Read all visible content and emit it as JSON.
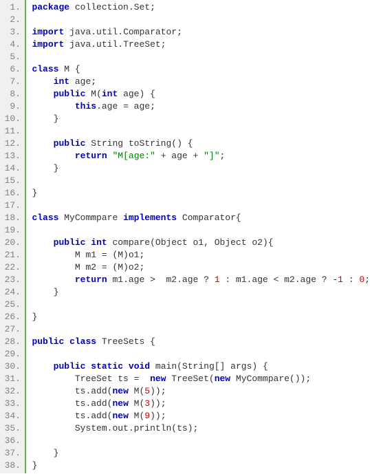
{
  "lines": [
    {
      "n": "1.",
      "tokens": [
        {
          "cls": "kw",
          "t": "package"
        },
        {
          "cls": "pln",
          "t": " collection.Set;"
        }
      ]
    },
    {
      "n": "2.",
      "tokens": []
    },
    {
      "n": "3.",
      "tokens": [
        {
          "cls": "kw",
          "t": "import"
        },
        {
          "cls": "pln",
          "t": " java.util.Comparator;"
        }
      ]
    },
    {
      "n": "4.",
      "tokens": [
        {
          "cls": "kw",
          "t": "import"
        },
        {
          "cls": "pln",
          "t": " java.util.TreeSet;"
        }
      ]
    },
    {
      "n": "5.",
      "tokens": []
    },
    {
      "n": "6.",
      "tokens": [
        {
          "cls": "kw",
          "t": "class"
        },
        {
          "cls": "pln",
          "t": " M {"
        }
      ]
    },
    {
      "n": "7.",
      "tokens": [
        {
          "cls": "pln",
          "t": "    "
        },
        {
          "cls": "kw",
          "t": "int"
        },
        {
          "cls": "pln",
          "t": " age;"
        }
      ]
    },
    {
      "n": "8.",
      "tokens": [
        {
          "cls": "pln",
          "t": "    "
        },
        {
          "cls": "kw",
          "t": "public"
        },
        {
          "cls": "pln",
          "t": " M("
        },
        {
          "cls": "kw",
          "t": "int"
        },
        {
          "cls": "pln",
          "t": " age) {"
        }
      ]
    },
    {
      "n": "9.",
      "tokens": [
        {
          "cls": "pln",
          "t": "        "
        },
        {
          "cls": "kw",
          "t": "this"
        },
        {
          "cls": "pln",
          "t": ".age = age;"
        }
      ]
    },
    {
      "n": "10.",
      "tokens": [
        {
          "cls": "pln",
          "t": "    }"
        }
      ]
    },
    {
      "n": "11.",
      "tokens": []
    },
    {
      "n": "12.",
      "tokens": [
        {
          "cls": "pln",
          "t": "    "
        },
        {
          "cls": "kw",
          "t": "public"
        },
        {
          "cls": "pln",
          "t": " String toString() {"
        }
      ]
    },
    {
      "n": "13.",
      "tokens": [
        {
          "cls": "pln",
          "t": "        "
        },
        {
          "cls": "kw",
          "t": "return"
        },
        {
          "cls": "pln",
          "t": " "
        },
        {
          "cls": "str",
          "t": "\"M[age:\""
        },
        {
          "cls": "pln",
          "t": " + age + "
        },
        {
          "cls": "str",
          "t": "\"]\""
        },
        {
          "cls": "pln",
          "t": ";"
        }
      ]
    },
    {
      "n": "14.",
      "tokens": [
        {
          "cls": "pln",
          "t": "    }"
        }
      ]
    },
    {
      "n": "15.",
      "tokens": []
    },
    {
      "n": "16.",
      "tokens": [
        {
          "cls": "pln",
          "t": "}"
        }
      ]
    },
    {
      "n": "17.",
      "tokens": []
    },
    {
      "n": "18.",
      "tokens": [
        {
          "cls": "kw",
          "t": "class"
        },
        {
          "cls": "pln",
          "t": " MyCommpare "
        },
        {
          "cls": "kw",
          "t": "implements"
        },
        {
          "cls": "pln",
          "t": " Comparator{"
        }
      ]
    },
    {
      "n": "19.",
      "tokens": []
    },
    {
      "n": "20.",
      "tokens": [
        {
          "cls": "pln",
          "t": "    "
        },
        {
          "cls": "kw",
          "t": "public"
        },
        {
          "cls": "pln",
          "t": " "
        },
        {
          "cls": "kw",
          "t": "int"
        },
        {
          "cls": "pln",
          "t": " compare(Object o1, Object o2){"
        }
      ]
    },
    {
      "n": "21.",
      "tokens": [
        {
          "cls": "pln",
          "t": "        M m1 = (M)o1;"
        }
      ]
    },
    {
      "n": "22.",
      "tokens": [
        {
          "cls": "pln",
          "t": "        M m2 = (M)o2;"
        }
      ]
    },
    {
      "n": "23.",
      "tokens": [
        {
          "cls": "pln",
          "t": "        "
        },
        {
          "cls": "kw",
          "t": "return"
        },
        {
          "cls": "pln",
          "t": " m1.age >  m2.age ? "
        },
        {
          "cls": "num",
          "t": "1"
        },
        {
          "cls": "pln",
          "t": " : m1.age < m2.age ? -"
        },
        {
          "cls": "num",
          "t": "1"
        },
        {
          "cls": "pln",
          "t": " : "
        },
        {
          "cls": "num",
          "t": "0"
        },
        {
          "cls": "pln",
          "t": ";"
        }
      ]
    },
    {
      "n": "24.",
      "tokens": [
        {
          "cls": "pln",
          "t": "    }"
        }
      ]
    },
    {
      "n": "25.",
      "tokens": []
    },
    {
      "n": "26.",
      "tokens": [
        {
          "cls": "pln",
          "t": "}"
        }
      ]
    },
    {
      "n": "27.",
      "tokens": []
    },
    {
      "n": "28.",
      "tokens": [
        {
          "cls": "kw",
          "t": "public"
        },
        {
          "cls": "pln",
          "t": " "
        },
        {
          "cls": "kw",
          "t": "class"
        },
        {
          "cls": "pln",
          "t": " TreeSets {"
        }
      ]
    },
    {
      "n": "29.",
      "tokens": []
    },
    {
      "n": "30.",
      "tokens": [
        {
          "cls": "pln",
          "t": "    "
        },
        {
          "cls": "kw",
          "t": "public"
        },
        {
          "cls": "pln",
          "t": " "
        },
        {
          "cls": "kw",
          "t": "static"
        },
        {
          "cls": "pln",
          "t": " "
        },
        {
          "cls": "kw",
          "t": "void"
        },
        {
          "cls": "pln",
          "t": " main(String[] args) {"
        }
      ]
    },
    {
      "n": "31.",
      "tokens": [
        {
          "cls": "pln",
          "t": "        TreeSet ts =  "
        },
        {
          "cls": "kw",
          "t": "new"
        },
        {
          "cls": "pln",
          "t": " TreeSet("
        },
        {
          "cls": "kw",
          "t": "new"
        },
        {
          "cls": "pln",
          "t": " MyCommpare());"
        }
      ]
    },
    {
      "n": "32.",
      "tokens": [
        {
          "cls": "pln",
          "t": "        ts.add("
        },
        {
          "cls": "kw",
          "t": "new"
        },
        {
          "cls": "pln",
          "t": " M("
        },
        {
          "cls": "num",
          "t": "5"
        },
        {
          "cls": "pln",
          "t": "));"
        }
      ]
    },
    {
      "n": "33.",
      "tokens": [
        {
          "cls": "pln",
          "t": "        ts.add("
        },
        {
          "cls": "kw",
          "t": "new"
        },
        {
          "cls": "pln",
          "t": " M("
        },
        {
          "cls": "num",
          "t": "3"
        },
        {
          "cls": "pln",
          "t": "));"
        }
      ]
    },
    {
      "n": "34.",
      "tokens": [
        {
          "cls": "pln",
          "t": "        ts.add("
        },
        {
          "cls": "kw",
          "t": "new"
        },
        {
          "cls": "pln",
          "t": " M("
        },
        {
          "cls": "num",
          "t": "9"
        },
        {
          "cls": "pln",
          "t": "));"
        }
      ]
    },
    {
      "n": "35.",
      "tokens": [
        {
          "cls": "pln",
          "t": "        System.out.println(ts);"
        }
      ]
    },
    {
      "n": "36.",
      "tokens": []
    },
    {
      "n": "37.",
      "tokens": [
        {
          "cls": "pln",
          "t": "    }"
        }
      ]
    },
    {
      "n": "38.",
      "tokens": [
        {
          "cls": "pln",
          "t": "}"
        }
      ]
    }
  ]
}
